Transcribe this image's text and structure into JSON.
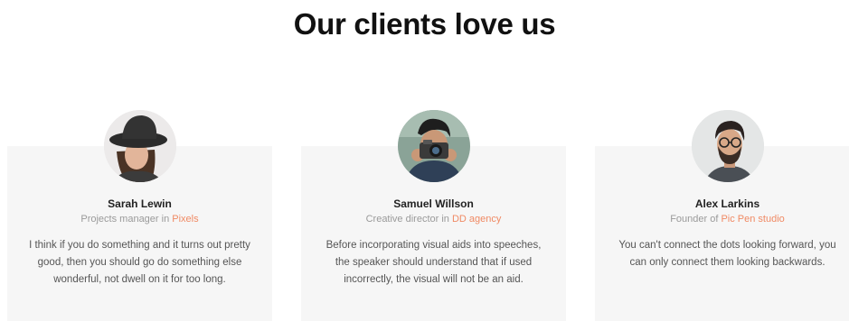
{
  "section": {
    "title": "Our clients love us"
  },
  "accent_color": "#f08a64",
  "card_background": "#f6f6f6",
  "testimonials": [
    {
      "name": "Sarah Lewin",
      "role_prefix": "Projects manager in ",
      "company": "Pixels",
      "quote": "I think if you do something and it turns out pretty good, then you should go do something else wonderful, not dwell on it for too long.",
      "avatar_icon": "person-photo-hat"
    },
    {
      "name": "Samuel Willson",
      "role_prefix": "Creative director in ",
      "company": "DD agency",
      "quote": "Before incorporating visual aids into speeches, the speaker should understand that if used incorrectly, the visual will not be an aid.",
      "avatar_icon": "person-photo-camera"
    },
    {
      "name": "Alex Larkins",
      "role_prefix": "Founder of ",
      "company": "Pic Pen studio",
      "quote": "You can't connect the dots looking forward, you can only connect them looking backwards.",
      "avatar_icon": "person-photo-glasses"
    }
  ]
}
